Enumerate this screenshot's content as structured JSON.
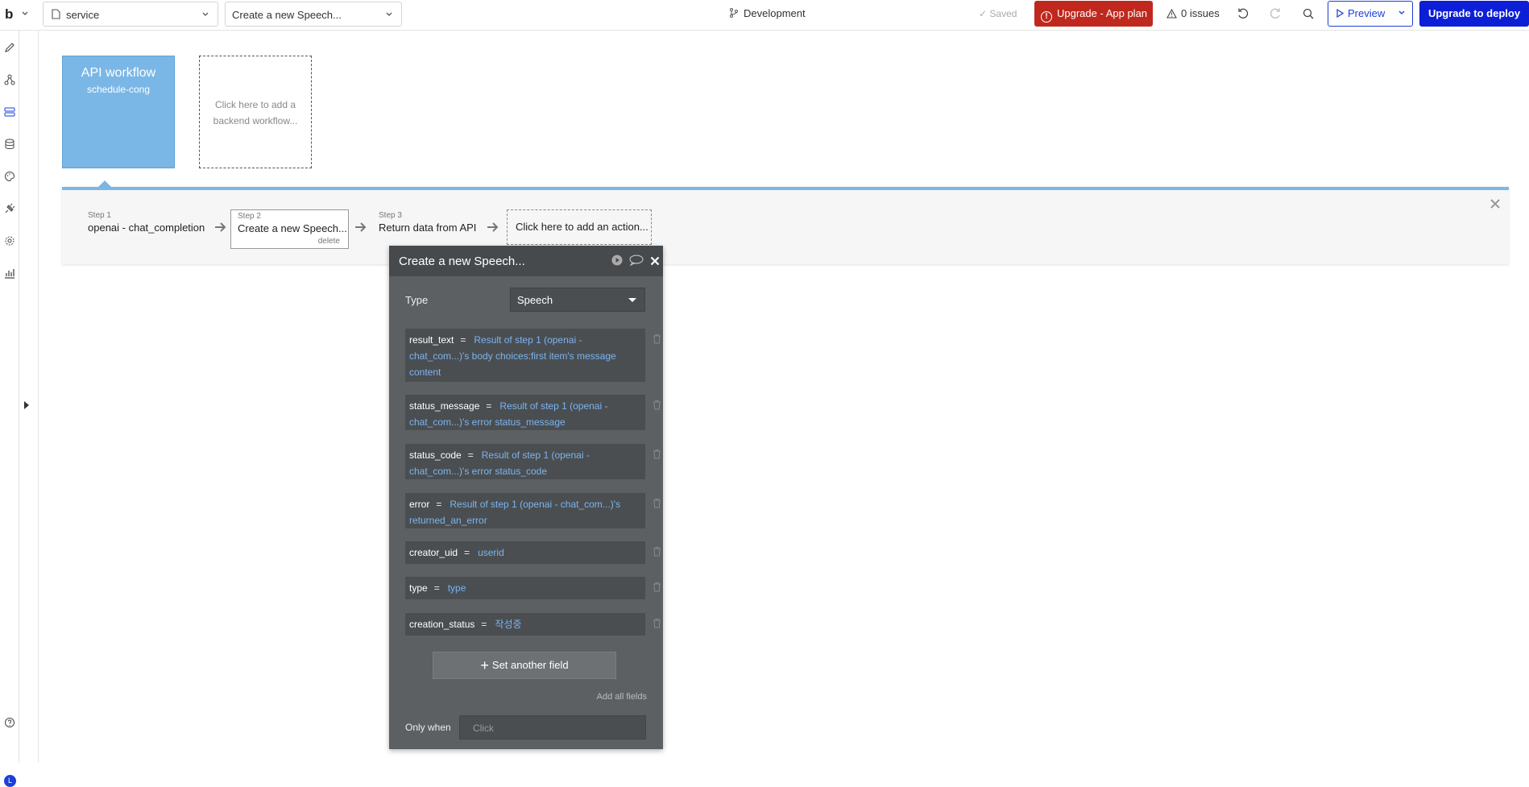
{
  "topbar": {
    "logo": "b",
    "page_select": "service",
    "workflow_select": "Create a new Speech...",
    "branch": "Development",
    "saved": "Saved",
    "upgrade_plan": "Upgrade - App plan",
    "issues": "0 issues",
    "preview": "Preview",
    "deploy": "Upgrade to deploy"
  },
  "sidebar": {
    "avatar": "L"
  },
  "canvas": {
    "api_workflow_title": "API workflow",
    "api_workflow_name": "schedule-cong",
    "add_workflow": "Click here to add a backend workflow..."
  },
  "steps": [
    {
      "label": "Step 1",
      "name": "openai - chat_completion"
    },
    {
      "label": "Step 2",
      "name": "Create a new Speech...",
      "delete": "delete"
    },
    {
      "label": "Step 3",
      "name": "Return data from API"
    }
  ],
  "add_action": "Click here to add an action...",
  "editor": {
    "title": "Create a new Speech...",
    "type_label": "Type",
    "type_value": "Speech",
    "fields": [
      {
        "key": "result_text",
        "eq": "=",
        "value": "Result of step 1 (openai - chat_com...)'s body choices:first item's message content"
      },
      {
        "key": "status_message",
        "eq": "=",
        "value": "Result of step 1 (openai - chat_com...)'s error status_message"
      },
      {
        "key": "status_code",
        "eq": "=",
        "value": "Result of step 1 (openai - chat_com...)'s error status_code"
      },
      {
        "key": "error",
        "eq": "=",
        "value": "Result of step 1 (openai - chat_com...)'s returned_an_error"
      },
      {
        "key": "creator_uid",
        "eq": "=",
        "value": "userid"
      },
      {
        "key": "type",
        "eq": "=",
        "value": "type"
      },
      {
        "key": "creation_status",
        "eq": "=",
        "value": "작성중"
      }
    ],
    "set_another_field": "Set another field",
    "add_all_fields": "Add all fields",
    "only_when_label": "Only when",
    "only_when_placeholder": "Click"
  },
  "colors": {
    "accent_blue": "#0d1fd6",
    "upgrade_red": "#c0281e",
    "workflow_blue": "#7ab7e6",
    "expression_blue": "#7ab4f2"
  }
}
